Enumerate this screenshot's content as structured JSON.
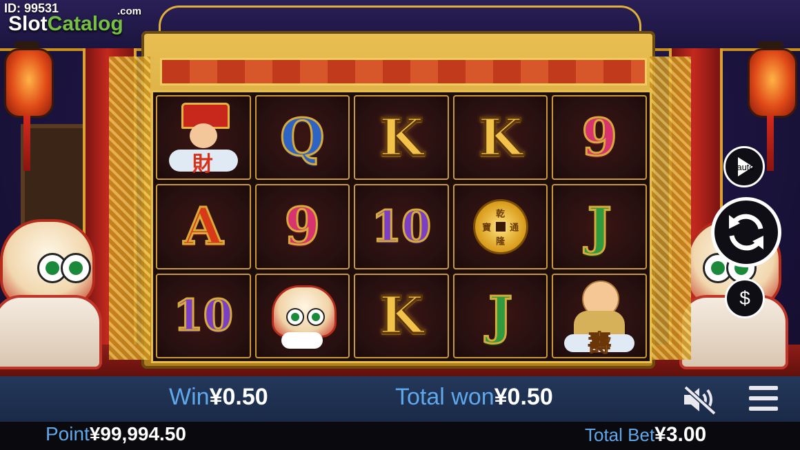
{
  "watermark": {
    "id_text": "ID: 99531",
    "logo_part1": "Slot",
    "logo_part2": "Catalog",
    "logo_suffix": ".com"
  },
  "reels": [
    [
      "god-of-wealth",
      "Q",
      "K",
      "K",
      "9"
    ],
    [
      "A",
      "9",
      "10",
      "coin",
      "J"
    ],
    [
      "10",
      "lion",
      "K",
      "J",
      "longevity-elder"
    ]
  ],
  "symbols": {
    "god_glyph": "財",
    "elder_glyph": "壽",
    "coin_glyphs": [
      "乾",
      "隆",
      "通",
      "寶"
    ]
  },
  "controls": {
    "auto_label": "auto",
    "bet_symbol": "$"
  },
  "info": {
    "win_label": "Win",
    "win_value": "¥0.50",
    "total_won_label": "Total won",
    "total_won_value": "¥0.50",
    "point_label": "Point",
    "point_value": "¥99,994.50",
    "total_bet_label": "Total Bet",
    "total_bet_value": "¥3.00"
  },
  "sound_muted": true
}
